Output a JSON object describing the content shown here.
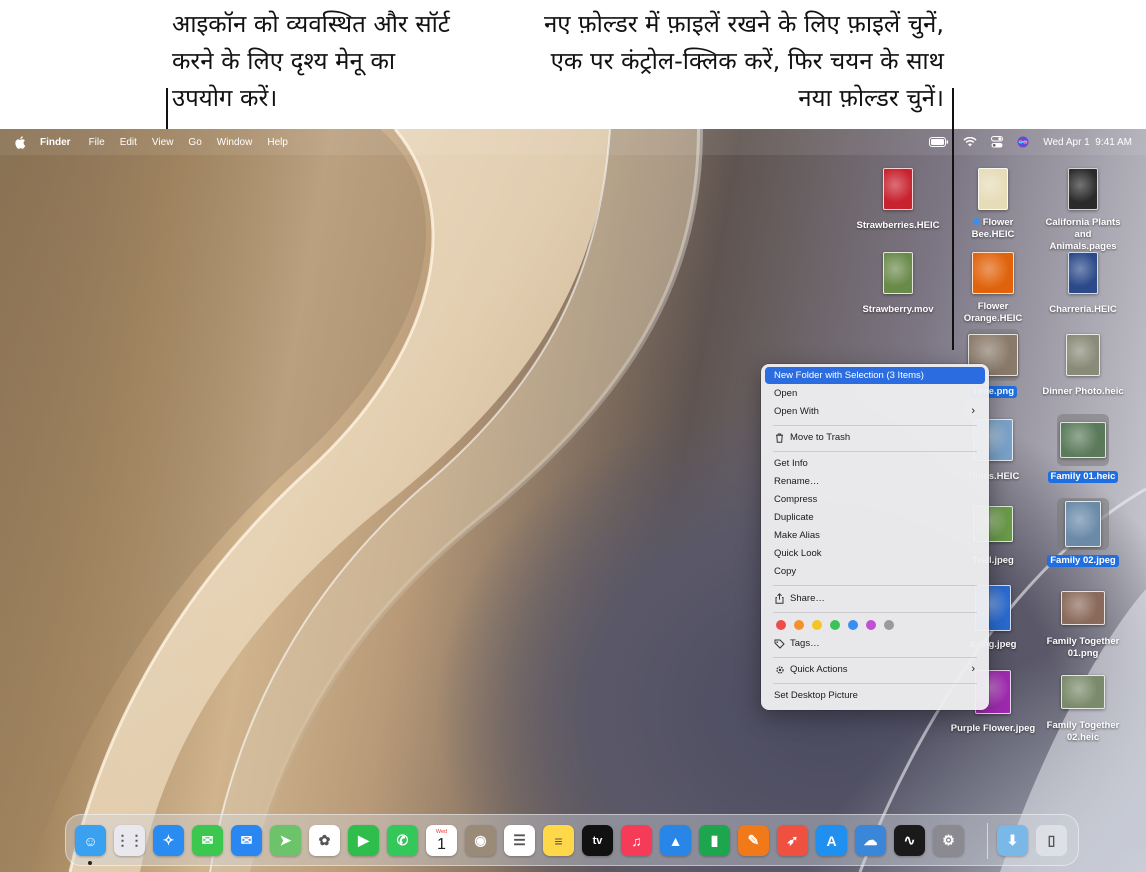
{
  "callouts": {
    "left": "आइकॉन को व्यवस्थित और सॉर्ट करने के लिए दृश्य मेनू का उपयोग करें।",
    "right": "नए फ़ोल्डर में फ़ाइलें रखने के लिए फ़ाइलें चुनें, एक पर कंट्रोल-क्लिक करें, फिर चयन के साथ नया फ़ोल्डर चुनें।"
  },
  "menubar": {
    "app_name": "Finder",
    "menus": [
      "File",
      "Edit",
      "View",
      "Go",
      "Window",
      "Help"
    ],
    "clock": "Wed Apr 1  9:41 AM"
  },
  "desktop_icons": [
    {
      "name": "Strawberries.HEIC",
      "selected": false,
      "color": "#c8222e"
    },
    {
      "name": "Flower Bee.HEIC",
      "selected": false,
      "tag": "blue",
      "color": "#e6dcb8"
    },
    {
      "name": "California Plants and Animals.pages",
      "selected": false,
      "color": "#2a2a2a"
    },
    {
      "name": "Strawberry.mov",
      "selected": false,
      "color": "#6a8a4a"
    },
    {
      "name": "Flower Orange.HEIC",
      "selected": false,
      "color": "#e0620a"
    },
    {
      "name": "Charreria.HEIC",
      "selected": false,
      "color": "#2c4a8a"
    },
    {
      "name": "Time.png",
      "selected": true,
      "color": "#8a7a6a"
    },
    {
      "name": "Dinner Photo.heic",
      "selected": false,
      "color": "#8a8a78"
    },
    {
      "name": "Times.HEIC",
      "selected": false,
      "color": "#7aa2c8"
    },
    {
      "name": "Family 01.heic",
      "selected": true,
      "color": "#5a7a5a"
    },
    {
      "name": "Trail.jpeg",
      "selected": false,
      "color": "#6a9a4a"
    },
    {
      "name": "Family 02.jpeg",
      "selected": true,
      "color": "#6a8aa8"
    },
    {
      "name": "aying.jpeg",
      "selected": false,
      "color": "#2a6ad0"
    },
    {
      "name": "Family Together 01.png",
      "selected": false,
      "color": "#8a6a5a"
    },
    {
      "name": "Purple Flower.jpeg",
      "selected": false,
      "color": "#a02ab0"
    },
    {
      "name": "Family Together 02.heic",
      "selected": false,
      "color": "#7a8a6a"
    }
  ],
  "context_menu": {
    "items": [
      {
        "label": "New Folder with Selection (3 Items)",
        "highlighted": true
      },
      {
        "label": "Open"
      },
      {
        "label": "Open With",
        "submenu": true
      },
      {
        "label": "Move to Trash",
        "icon": "trash-icon"
      },
      {
        "label": "Get Info"
      },
      {
        "label": "Rename…"
      },
      {
        "label": "Compress"
      },
      {
        "label": "Duplicate"
      },
      {
        "label": "Make Alias"
      },
      {
        "label": "Quick Look"
      },
      {
        "label": "Copy"
      },
      {
        "label": "Share…",
        "icon": "share-icon"
      },
      {
        "label": "Tags…",
        "icon": "tag-icon"
      },
      {
        "label": "Quick Actions",
        "icon": "gear-icon",
        "submenu": true
      },
      {
        "label": "Set Desktop Picture"
      }
    ],
    "tag_colors": [
      "#ef4b4b",
      "#f5902e",
      "#f3c623",
      "#3cc25a",
      "#3a8ef0",
      "#c04fd8",
      "#9a9a9a"
    ]
  },
  "calendar_icon": {
    "day": "Wed",
    "date": "1"
  },
  "dock": {
    "apps": [
      {
        "name": "finder",
        "color": "#3aa0f0",
        "running": true
      },
      {
        "name": "launchpad",
        "color": "#e8e8ee"
      },
      {
        "name": "safari",
        "color": "#2a8cf0"
      },
      {
        "name": "messages",
        "color": "#3cc84e"
      },
      {
        "name": "mail",
        "color": "#2a86f0"
      },
      {
        "name": "maps",
        "color": "#6cc36a"
      },
      {
        "name": "photos",
        "color": "#ffffff"
      },
      {
        "name": "facetime",
        "color": "#2fbe4c"
      },
      {
        "name": "phone",
        "color": "#34c759"
      },
      {
        "name": "calendar",
        "color": "#ffffff"
      },
      {
        "name": "contacts",
        "color": "#9a8a78"
      },
      {
        "name": "reminders",
        "color": "#ffffff"
      },
      {
        "name": "notes",
        "color": "#ffd84a"
      },
      {
        "name": "tv",
        "color": "#111111",
        "label": "tv"
      },
      {
        "name": "music",
        "color": "#f53b57"
      },
      {
        "name": "keynote",
        "color": "#2a86e6"
      },
      {
        "name": "numbers",
        "color": "#1ea64e"
      },
      {
        "name": "pages",
        "color": "#f07a1a"
      },
      {
        "name": "rocket",
        "color": "#f05040"
      },
      {
        "name": "app-store",
        "color": "#1f8ff0"
      },
      {
        "name": "weather",
        "color": "#3a86d8"
      },
      {
        "name": "stocks",
        "color": "#1a1a1a"
      },
      {
        "name": "system-settings",
        "color": "#8a8a90"
      },
      {
        "name": "downloads-folder",
        "color": "#7ab8e8"
      },
      {
        "name": "trash",
        "color": "#cfd3da"
      }
    ]
  }
}
